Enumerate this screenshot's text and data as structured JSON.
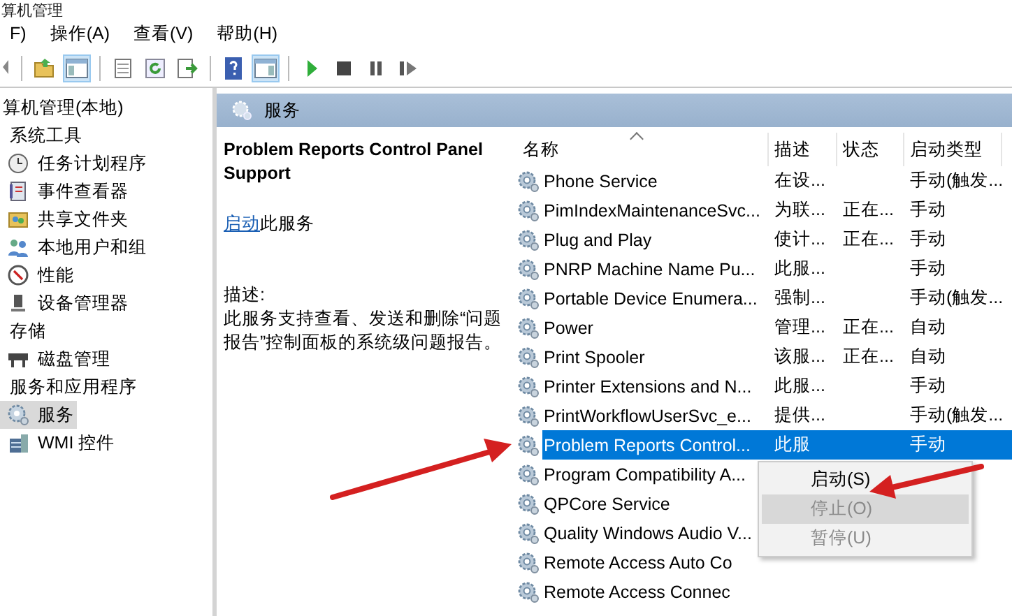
{
  "window": {
    "title": "算机管理"
  },
  "menu": [
    {
      "label": "F)"
    },
    {
      "label": "操作(A)"
    },
    {
      "label": "查看(V)"
    },
    {
      "label": "帮助(H)"
    }
  ],
  "tree": [
    {
      "label": "算机管理(本地)",
      "kind": "category",
      "selected": false,
      "children": [
        {
          "label": "系统工具",
          "kind": "category",
          "selected": false,
          "children": [
            {
              "label": "任务计划程序",
              "kind": "tool",
              "selected": false
            },
            {
              "label": "事件查看器",
              "kind": "tool",
              "selected": false
            },
            {
              "label": "共享文件夹",
              "kind": "tool",
              "selected": false
            },
            {
              "label": "本地用户和组",
              "kind": "tool",
              "selected": false
            },
            {
              "label": "性能",
              "kind": "tool",
              "selected": false
            },
            {
              "label": "设备管理器",
              "kind": "tool",
              "selected": false
            }
          ]
        },
        {
          "label": "存储",
          "kind": "category",
          "selected": false,
          "children": [
            {
              "label": "磁盘管理",
              "kind": "tool",
              "selected": false
            }
          ]
        },
        {
          "label": "服务和应用程序",
          "kind": "category",
          "selected": false,
          "children": [
            {
              "label": "服务",
              "kind": "tool",
              "selected": true
            },
            {
              "label": "WMI 控件",
              "kind": "tool",
              "selected": false
            }
          ]
        }
      ]
    }
  ],
  "panel": {
    "title": "服务"
  },
  "detail": {
    "service_name": "Problem Reports Control Panel Support",
    "action_link": "启动",
    "action_text": "此服务",
    "description_label": "描述:",
    "description": "此服务支持查看、发送和删除“问题报告”控制面板的系统级问题报告。"
  },
  "services": {
    "columns": [
      {
        "label": "名称",
        "sorted": true
      },
      {
        "label": "描述",
        "sorted": false
      },
      {
        "label": "状态",
        "sorted": false
      },
      {
        "label": "启动类型",
        "sorted": false
      }
    ],
    "rows": [
      {
        "name": "Phone Service",
        "description": "在设...",
        "status": "",
        "startup": "手动(触发...",
        "selected": false
      },
      {
        "name": "PimIndexMaintenanceSvc...",
        "description": "为联...",
        "status": "正在...",
        "startup": "手动",
        "selected": false
      },
      {
        "name": "Plug and Play",
        "description": "使计...",
        "status": "正在...",
        "startup": "手动",
        "selected": false
      },
      {
        "name": "PNRP Machine Name Pu...",
        "description": "此服...",
        "status": "",
        "startup": "手动",
        "selected": false
      },
      {
        "name": "Portable Device Enumera...",
        "description": "强制...",
        "status": "",
        "startup": "手动(触发...",
        "selected": false
      },
      {
        "name": "Power",
        "description": "管理...",
        "status": "正在...",
        "startup": "自动",
        "selected": false
      },
      {
        "name": "Print Spooler",
        "description": "该服...",
        "status": "正在...",
        "startup": "自动",
        "selected": false
      },
      {
        "name": "Printer Extensions and N...",
        "description": "此服...",
        "status": "",
        "startup": "手动",
        "selected": false
      },
      {
        "name": "PrintWorkflowUserSvc_e...",
        "description": "提供...",
        "status": "",
        "startup": "手动(触发...",
        "selected": false
      },
      {
        "name": "Problem Reports Control...",
        "description": "此服",
        "status": "",
        "startup": "手动",
        "selected": true
      },
      {
        "name": "Program Compatibility A...",
        "description": "",
        "status": "",
        "startup": "",
        "selected": false
      },
      {
        "name": "QPCore Service",
        "description": "",
        "status": "",
        "startup": "",
        "selected": false
      },
      {
        "name": "Quality Windows Audio V...",
        "description": "",
        "status": "",
        "startup": "",
        "selected": false
      },
      {
        "name": "Remote Access Auto Co",
        "description": "",
        "status": "",
        "startup": "",
        "selected": false
      },
      {
        "name": "Remote Access Connec",
        "description": "",
        "status": "",
        "startup": "",
        "selected": false
      }
    ]
  },
  "context_menu": [
    {
      "label": "启动(S)",
      "disabled": false,
      "selected": false
    },
    {
      "label": "停止(O)",
      "disabled": true,
      "selected": true
    },
    {
      "label": "暂停(U)",
      "disabled": true,
      "selected": false
    }
  ]
}
